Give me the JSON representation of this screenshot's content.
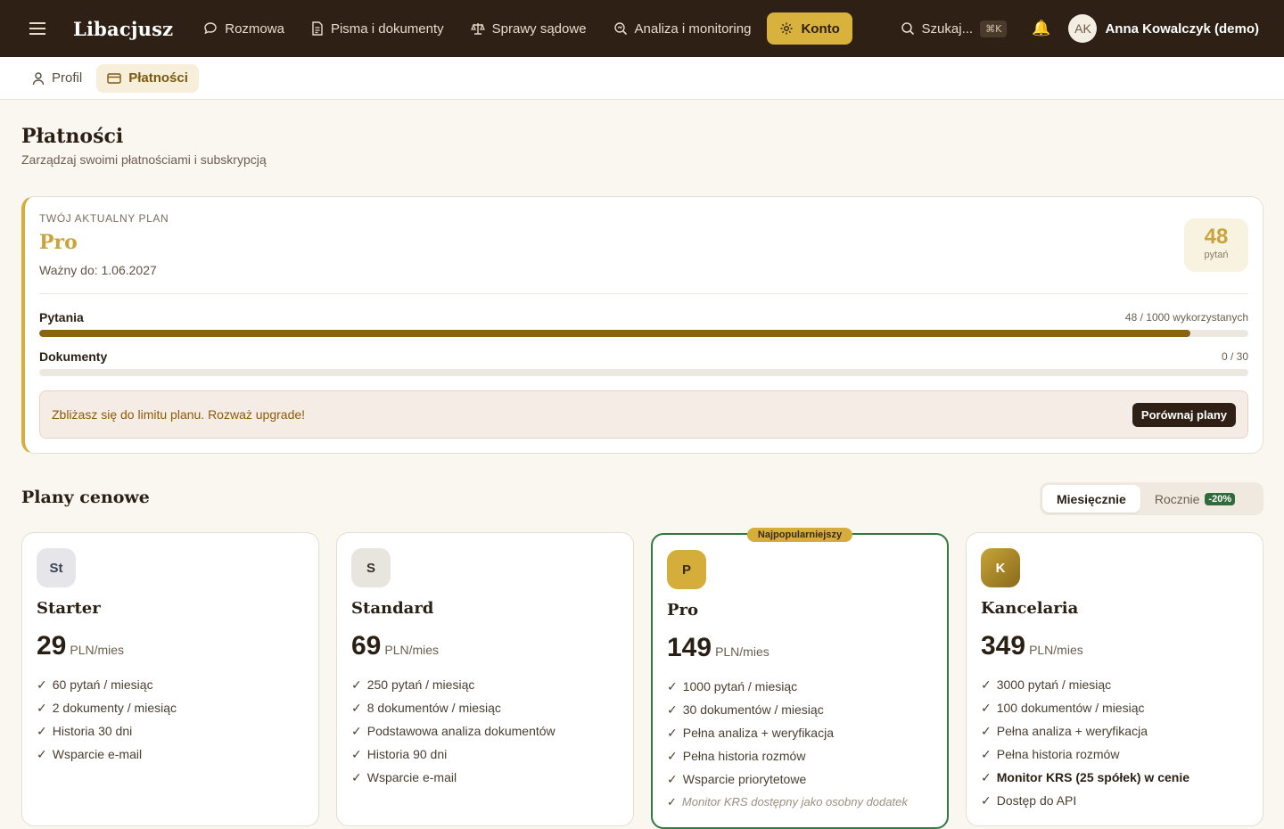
{
  "nav": {
    "brand": "Libacjusz",
    "links": [
      {
        "label": "Rozmowa",
        "icon": "chat-bubble-icon"
      },
      {
        "label": "Pisma i dokumenty",
        "icon": "document-icon"
      },
      {
        "label": "Sprawy sądowe",
        "icon": "scales-icon"
      },
      {
        "label": "Analiza i monitoring",
        "icon": "magnifier-icon"
      },
      {
        "label": "Konto",
        "icon": "gear-icon",
        "active": true
      }
    ],
    "search_label": "Szukaj...",
    "search_shortcut": "⌘K",
    "user_initials": "AK",
    "user_name": "Anna Kowalczyk (demo)"
  },
  "subtabs": [
    {
      "label": "Profil",
      "icon": "user-icon"
    },
    {
      "label": "Płatności",
      "icon": "card-icon",
      "active": true
    }
  ],
  "page": {
    "title": "Płatności",
    "subtitle": "Zarządzaj swoimi płatnościami i subskrypcją"
  },
  "current_plan": {
    "eyebrow": "TWÓJ AKTUALNY PLAN",
    "name": "Pro",
    "valid_until": "Ważny do: 1.06.2027",
    "count": "48",
    "count_label": "pytań",
    "usage": [
      {
        "label": "Pytania",
        "value": "48 / 1000 wykorzystanych",
        "fill": 0.952
      },
      {
        "label": "Dokumenty",
        "value": "0 / 30",
        "fill": 0.0
      }
    ],
    "warning": "Zbliżasz się do limitu planu. Rozważ upgrade!",
    "compare_label": "Porównaj plany"
  },
  "pricing": {
    "title": "Plany cenowe",
    "toggle_monthly": "Miesięcznie",
    "toggle_yearly": "Rocznie",
    "yearly_discount": "-20%",
    "popular_badge": "Najpopularniejszy",
    "plans": [
      {
        "initials": "St",
        "name": "Starter",
        "price": "29",
        "unit": "PLN/mies",
        "features": [
          "60 pytań / miesiąc",
          "2 dokumenty / miesiąc",
          "Historia 30 dni",
          "Wsparcie e-mail"
        ]
      },
      {
        "initials": "S",
        "name": "Standard",
        "price": "69",
        "unit": "PLN/mies",
        "features": [
          "250 pytań / miesiąc",
          "8 dokumentów / miesiąc",
          "Podstawowa analiza dokumentów",
          "Historia 90 dni",
          "Wsparcie e-mail"
        ]
      },
      {
        "initials": "P",
        "name": "Pro",
        "price": "149",
        "unit": "PLN/mies",
        "features": [
          "1000 pytań / miesiąc",
          "30 dokumentów / miesiąc",
          "Pełna analiza + weryfikacja",
          "Pełna historia rozmów",
          "Wsparcie priorytetowe"
        ],
        "note": "Monitor KRS dostępny jako osobny dodatek"
      },
      {
        "initials": "K",
        "name": "Kancelaria",
        "price": "349",
        "unit": "PLN/mies",
        "features": [
          "3000 pytań / miesiąc",
          "100 dokumentów / miesiąc",
          "Pełna analiza + weryfikacja",
          "Pełna historia rozmów"
        ],
        "strong_feature": "Monitor KRS (25 spółek) w cenie",
        "extra_feature": "Dostęp do API"
      }
    ]
  },
  "colors": {
    "nav_bg": "#2e2014",
    "accent_gold": "#d4ad3b",
    "progress": "#8a6411",
    "popular_border": "#2f7a3e"
  }
}
